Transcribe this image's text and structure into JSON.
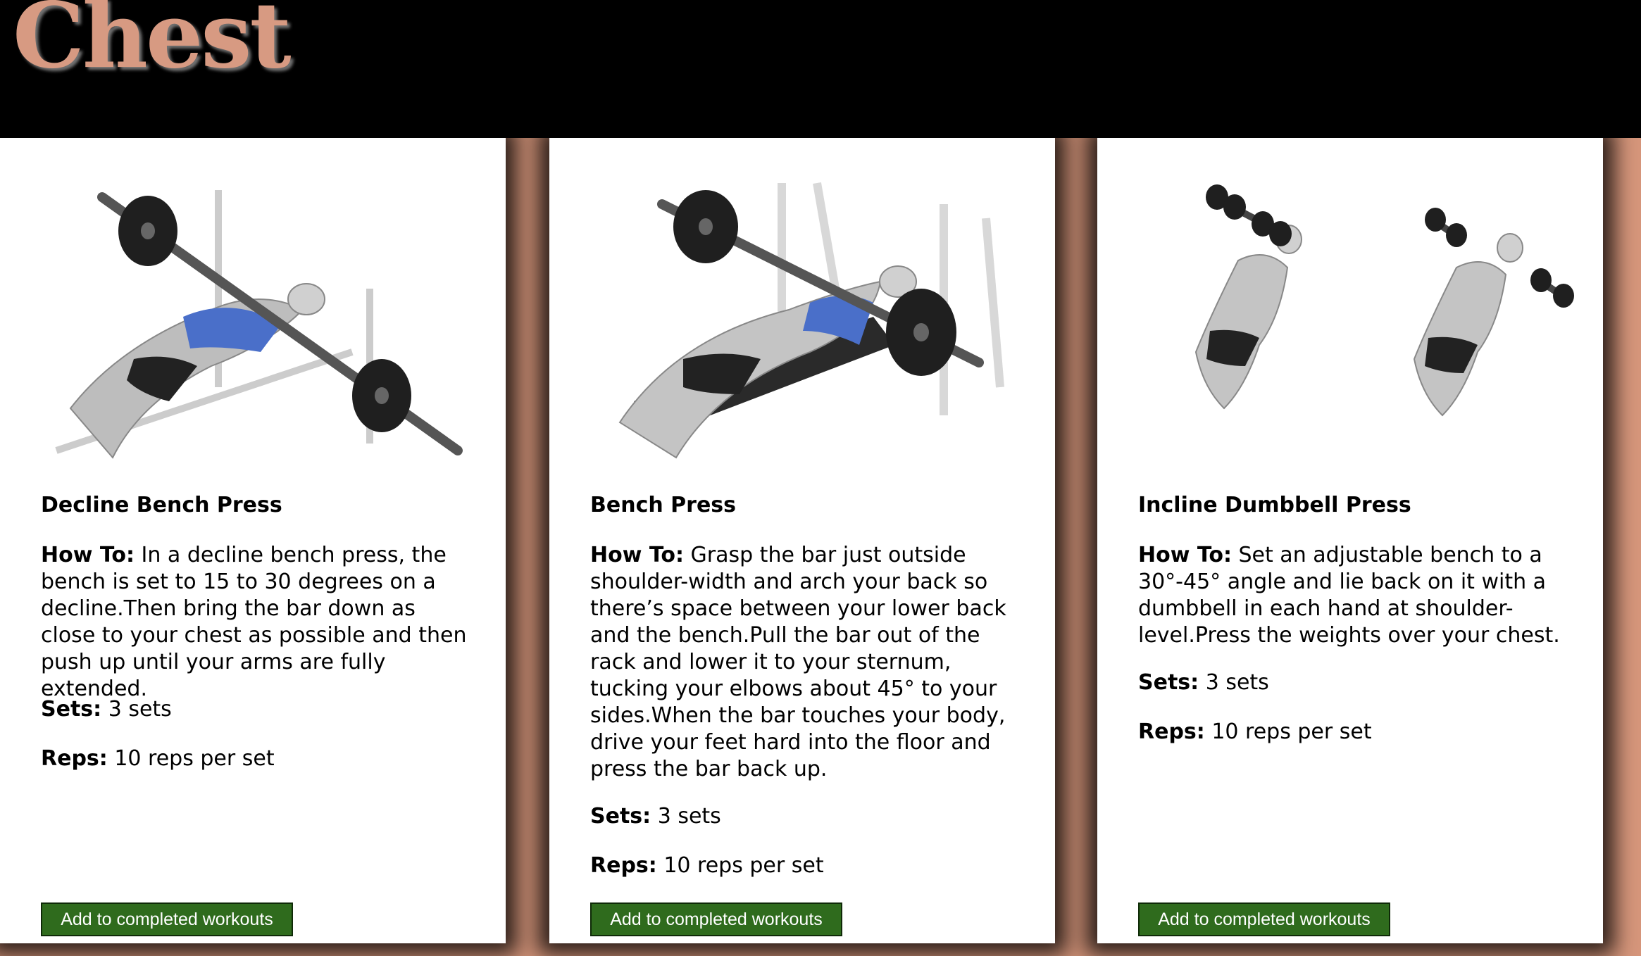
{
  "page": {
    "title": "Chest"
  },
  "accent_color": "#d6967b",
  "button_color": "#2f6b1d",
  "cards": [
    {
      "name": "Decline Bench Press",
      "how_to_label": "How To:",
      "how_to_text": " In a decline bench press, the bench is set to 15 to 30 degrees on a decline.Then bring the bar down as close to your chest as possible and then push up until your arms are fully extended.",
      "sets_label": "Sets:",
      "sets_value": " 3 sets",
      "reps_label": "Reps:",
      "reps_value": " 10 reps per set",
      "button_label": "Add to completed workouts",
      "image": "decline-bench-press-illustration"
    },
    {
      "name": "Bench Press",
      "how_to_label": "How To:",
      "how_to_text": " Grasp the bar just outside shoulder-width and arch your back so there’s space between your lower back and the bench.Pull the bar out of the rack and lower it to your sternum, tucking your elbows about 45° to your sides.When the bar touches your body, drive your feet hard into the floor and press the bar back up.",
      "sets_label": "Sets:",
      "sets_value": " 3 sets",
      "reps_label": "Reps:",
      "reps_value": " 10 reps per set",
      "button_label": "Add to completed workouts",
      "image": "bench-press-illustration"
    },
    {
      "name": "Incline Dumbbell Press",
      "how_to_label": "How To:",
      "how_to_text": " Set an adjustable bench to a 30°-45° angle and lie back on it with a dumbbell in each hand at shoulder-level.Press the weights over your chest.",
      "sets_label": "Sets:",
      "sets_value": " 3 sets",
      "reps_label": "Reps:",
      "reps_value": " 10 reps per set",
      "button_label": "Add to completed workouts",
      "image": "incline-dumbbell-press-illustration"
    }
  ]
}
